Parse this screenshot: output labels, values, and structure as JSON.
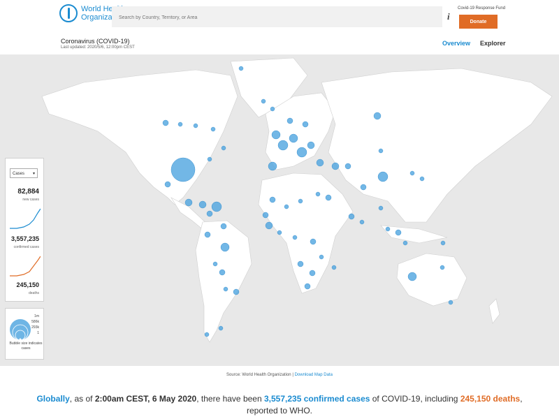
{
  "header": {
    "org_name_line1": "World Health",
    "org_name_line2": "Organization",
    "search_placeholder": "Search by Country, Territory, or Area",
    "info_icon": "i",
    "fund_label": "Covid-19 Response Fund",
    "donate_label": "Donate"
  },
  "subheader": {
    "title": "Coronavirus (COVID-19)",
    "updated": "Last updated: 2020/5/6, 12:00pm CEST"
  },
  "tabs": {
    "overview": "Overview",
    "explorer": "Explorer"
  },
  "stats": {
    "dropdown": "Cases",
    "new_cases": "82,884",
    "new_cases_label": "new cases",
    "confirmed": "3,557,235",
    "confirmed_label": "confirmed cases",
    "deaths": "245,150",
    "deaths_label": "deaths",
    "confirmed_trend_color": "#1a8bd0",
    "deaths_trend_color": "#e06c26"
  },
  "legend": {
    "values": [
      "1m",
      "586k",
      "293k",
      "1"
    ],
    "text": "Bubble size indicates cases"
  },
  "source": {
    "text": "Source: World Health Organization",
    "separator": "|",
    "link": "Download Map Data"
  },
  "summary": {
    "globally": "Globally",
    "as_of": ", as of ",
    "time": "2:00am CEST, 6 May 2020",
    "mid": ", there have been ",
    "confirmed": "3,557,235 confirmed cases",
    "mid2": " of COVID-19, including ",
    "deaths": "245,150 deaths",
    "end": ",",
    "line2": "reported to WHO."
  },
  "colors": {
    "accent": "#1a8bd0",
    "donate": "#e06c26",
    "bubble": "#4aa3df",
    "land": "#ffffff",
    "sea": "#e8e8e8"
  }
}
